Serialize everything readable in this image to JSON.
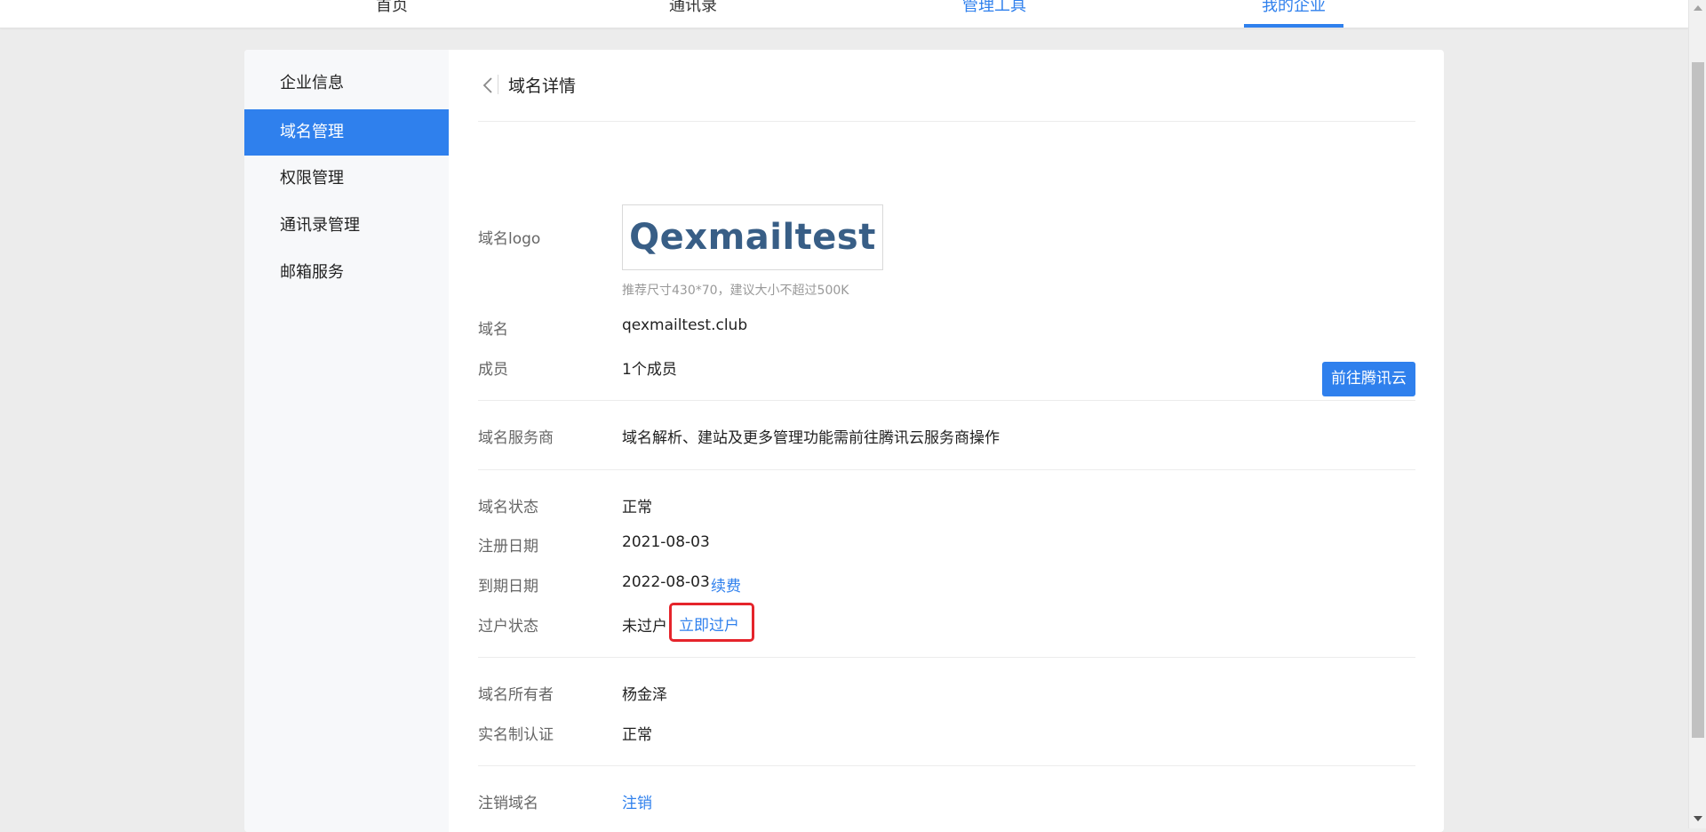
{
  "topnav": {
    "tabs": [
      {
        "label": "首页"
      },
      {
        "label": "通讯录"
      },
      {
        "label": "管理工具"
      },
      {
        "label": "我的企业"
      }
    ],
    "active_index": 3
  },
  "sidebar": {
    "items": [
      {
        "label": "企业信息"
      },
      {
        "label": "域名管理"
      },
      {
        "label": "权限管理"
      },
      {
        "label": "通讯录管理"
      },
      {
        "label": "邮箱服务"
      }
    ],
    "active_index": 1
  },
  "page": {
    "title": "域名详情"
  },
  "logo": {
    "label": "域名logo",
    "text": "Qexmailtest",
    "hint": "推荐尺寸430*70，建议大小不超过500K"
  },
  "domain": {
    "label": "域名",
    "value": "qexmailtest.club"
  },
  "members": {
    "label": "成员",
    "value": "1个成员"
  },
  "provider": {
    "label": "域名服务商",
    "value": "域名解析、建站及更多管理功能需前往腾讯云服务商操作",
    "button": "前往腾讯云"
  },
  "status": {
    "label": "域名状态",
    "value": "正常"
  },
  "reg_date": {
    "label": "注册日期",
    "value": "2021-08-03"
  },
  "expire_date": {
    "label": "到期日期",
    "value": "2022-08-03",
    "link": "续费"
  },
  "transfer": {
    "label": "过户状态",
    "value": "未过户",
    "link": "立即过户"
  },
  "owner": {
    "label": "域名所有者",
    "value": "杨金泽"
  },
  "realname": {
    "label": "实名制认证",
    "value": "正常"
  },
  "cancel": {
    "label": "注销域名",
    "link": "注销"
  },
  "colors": {
    "accent": "#2f80ed",
    "highlight": "#e5242b"
  }
}
